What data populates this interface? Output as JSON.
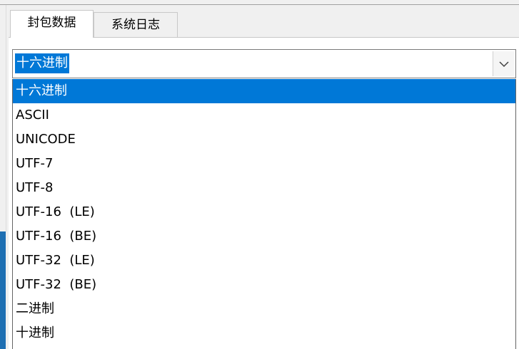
{
  "tabs": [
    {
      "label": "封包数据",
      "active": true
    },
    {
      "label": "系统日志",
      "active": false
    }
  ],
  "encoding_select": {
    "value": "十六进制",
    "options": [
      "十六进制",
      "ASCII",
      "UNICODE",
      "UTF-7",
      "UTF-8",
      "UTF-16  (LE)",
      "UTF-16  (BE)",
      "UTF-32  (LE)",
      "UTF-32  (BE)",
      "二进制",
      "十进制"
    ],
    "selected_index": 0
  },
  "icons": {
    "dropdown_arrow": "chevron-down-icon"
  },
  "colors": {
    "selection": "#0078d7",
    "window_background": "#f0f0f0",
    "accent_strip": "#1e6fb2"
  }
}
